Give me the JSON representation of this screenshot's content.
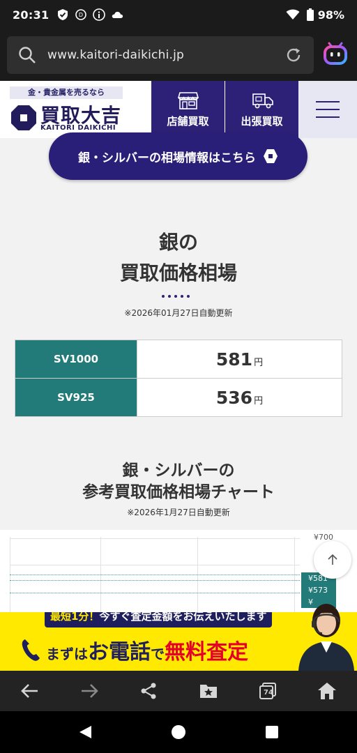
{
  "status_bar": {
    "time": "20:31",
    "battery": "98%",
    "icons": [
      "shield-check-icon",
      "data-saver-icon",
      "info-icon",
      "cloud-icon",
      "wifi-icon",
      "battery-icon"
    ]
  },
  "browser": {
    "url": "www.kaitori-daikichi.jp",
    "icons": [
      "search-icon",
      "reload-icon",
      "assistant-icon"
    ]
  },
  "site_header": {
    "tagline": "金・貴金属を売るなら",
    "logo_text": "買取大吉",
    "logo_roman": "KAITORI DAIKICHI",
    "nav": [
      {
        "label": "店舗買取",
        "icon": "store-icon"
      },
      {
        "label": "出張買取",
        "icon": "truck-icon"
      }
    ]
  },
  "silver_link": {
    "label": "銀・シルバーの相場情報はこちら"
  },
  "price_section": {
    "title_line1": "銀の",
    "title_line2": "買取価格相場",
    "updated": "※2026年01月27日自動更新",
    "unit": "円",
    "rows": [
      {
        "grade": "SV1000",
        "price": "581"
      },
      {
        "grade": "SV925",
        "price": "536"
      }
    ]
  },
  "chart_section": {
    "title_line1": "銀・シルバーの",
    "title_line2": "参考買取価格相場チャート",
    "updated": "※2026年1月27日自動更新",
    "tick_top": "¥700",
    "labels": [
      "¥581",
      "¥573",
      "¥"
    ]
  },
  "cta": {
    "top_prefix": "最短1分！",
    "top_text": "今すぐ査定金額をお伝えいたします",
    "b1": "まずは",
    "b2": "お電話",
    "b3": "で",
    "b4": "無料査定"
  },
  "toolbar": {
    "tabs_count": "74",
    "icons": [
      "back-arrow-icon",
      "forward-arrow-icon",
      "share-icon",
      "bookmark-folder-icon",
      "tabs-icon",
      "home-icon"
    ]
  },
  "colors": {
    "brand_navy": "#2d2077",
    "teal": "#227a79",
    "cta_yellow": "#ffe900",
    "cta_red": "#e4002b"
  }
}
